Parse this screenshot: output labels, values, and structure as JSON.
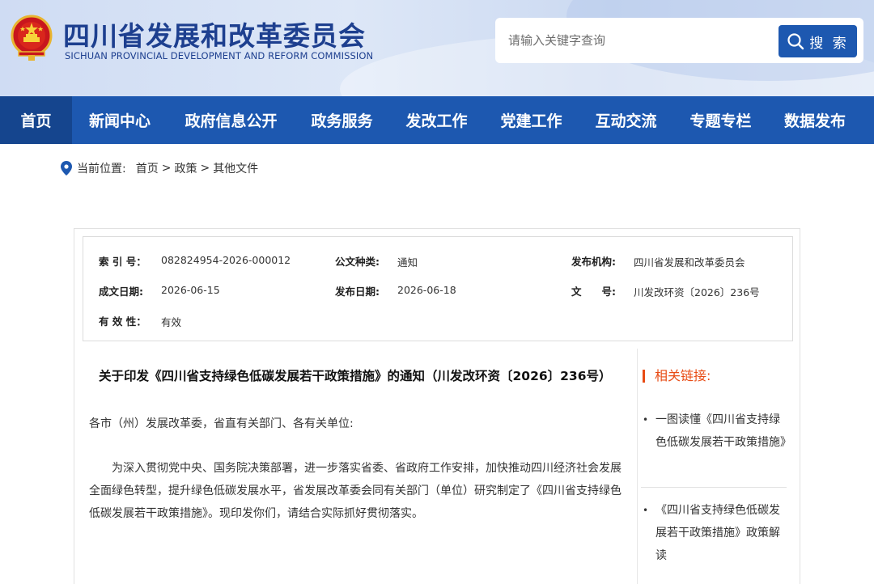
{
  "header": {
    "title": "四川省发展和改革委员会",
    "subtitle": "SICHUAN PROVINCIAL DEVELOPMENT AND REFORM COMMISSION",
    "search_placeholder": "请输入关键字查询",
    "search_button": "搜 索",
    "emblem_icon": "national-emblem-icon"
  },
  "nav": {
    "items": [
      {
        "label": "首页",
        "active": true
      },
      {
        "label": "新闻中心"
      },
      {
        "label": "政府信息公开"
      },
      {
        "label": "政务服务"
      },
      {
        "label": "发改工作"
      },
      {
        "label": "党建工作"
      },
      {
        "label": "互动交流"
      },
      {
        "label": "专题专栏"
      },
      {
        "label": "数据发布"
      }
    ]
  },
  "breadcrumb": {
    "prefix": "当前位置:",
    "items": [
      "首页",
      "政策",
      "其他文件"
    ],
    "separator": ">"
  },
  "meta": {
    "index_label": "索 引 号：",
    "index_value": "082824954-2026-000012",
    "type_label": "公文种类:",
    "type_value": "通知",
    "issuer_label": "发布机构:",
    "issuer_value": "四川省发展和改革委员会",
    "created_label": "成文日期:",
    "created_value": "2026-06-15",
    "published_label": "发布日期:",
    "published_value": "2026-06-18",
    "docno_label": "文　　号:",
    "docno_value": "川发改环资〔2026〕236号",
    "validity_label": "有 效 性：",
    "validity_value": "有效"
  },
  "document": {
    "title": "关于印发《四川省支持绿色低碳发展若干政策措施》的通知（川发改环资〔2026〕236号）",
    "greeting": "各市（州）发展改革委，省直有关部门、各有关单位:",
    "body": "为深入贯彻党中央、国务院决策部署，进一步落实省委、省政府工作安排，加快推动四川经济社会发展全面绿色转型，提升绿色低碳发展水平，省发展改革委会同有关部门（单位）研究制定了《四川省支持绿色低碳发展若干政策措施》。现印发你们，请结合实际抓好贯彻落实。"
  },
  "related": {
    "title": "相关链接:",
    "links": [
      "一图读懂《四川省支持绿色低碳发展若干政策措施》",
      "《四川省支持绿色低碳发展若干政策措施》政策解读"
    ]
  },
  "colors": {
    "brand_blue": "#1d58b0",
    "nav_active": "#15458e",
    "title_blue": "#1d3f8f",
    "accent_orange": "#e84b14"
  }
}
